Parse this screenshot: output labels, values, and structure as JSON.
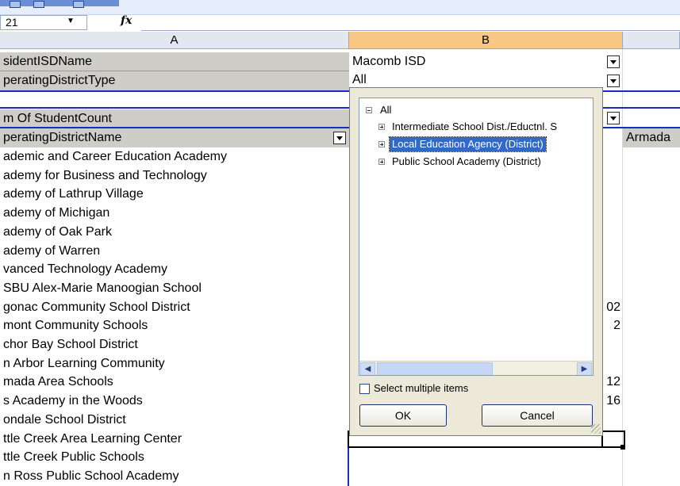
{
  "toolbar": {
    "icons": [
      "chevron-down-icon",
      "format-icon",
      "chevron-down-icon"
    ]
  },
  "name_box": {
    "value": "21"
  },
  "formula_bar": {
    "fx_label": "fx",
    "value": ""
  },
  "columns": [
    "A",
    "B"
  ],
  "sheet": {
    "page_fields": [
      {
        "name": "sidentISDName",
        "value": "Macomb ISD"
      },
      {
        "name": "peratingDistrictType",
        "value": "All"
      }
    ],
    "data_label": "m Of StudentCount",
    "row_field": "peratingDistrictName",
    "col_item": "Armada",
    "rows": [
      {
        "a": "ademic and Career Education Academy",
        "v": ""
      },
      {
        "a": "ademy for Business and Technology",
        "v": ""
      },
      {
        "a": "ademy of Lathrup Village",
        "v": ""
      },
      {
        "a": "ademy of Michigan",
        "v": ""
      },
      {
        "a": "ademy of Oak Park",
        "v": ""
      },
      {
        "a": "ademy of Warren",
        "v": ""
      },
      {
        "a": "vanced Technology Academy",
        "v": ""
      },
      {
        "a": "SBU Alex-Marie Manoogian School",
        "v": ""
      },
      {
        "a": "gonac Community School District",
        "v": "02"
      },
      {
        "a": "mont Community Schools",
        "v": "2"
      },
      {
        "a": "chor Bay School District",
        "v": ""
      },
      {
        "a": "n Arbor Learning Community",
        "v": ""
      },
      {
        "a": "mada Area Schools",
        "v": "12"
      },
      {
        "a": "s Academy in the Woods",
        "v": "16"
      },
      {
        "a": "ondale School District",
        "v": ""
      },
      {
        "a": "ttle Creek Area Learning Center",
        "v": ""
      },
      {
        "a": "ttle Creek Public Schools",
        "v": ""
      },
      {
        "a": "n Ross Public School Academy",
        "v": ""
      }
    ]
  },
  "filter_popup": {
    "tree": [
      {
        "label": "All",
        "expanded": true,
        "level": 0
      },
      {
        "label": "Intermediate School Dist./Eductnl. S",
        "expanded": false,
        "level": 1
      },
      {
        "label": "Local Education Agency (District)",
        "expanded": false,
        "level": 1,
        "selected": true
      },
      {
        "label": "Public School Academy (District)",
        "expanded": false,
        "level": 1
      }
    ],
    "multi_select_label": "Select multiple items",
    "multi_select_checked": false,
    "ok_label": "OK",
    "cancel_label": "Cancel"
  },
  "colors": {
    "selected_highlight": "#316ac5",
    "pivot_border": "#1a2dc2",
    "active_column": "#f8c784"
  }
}
